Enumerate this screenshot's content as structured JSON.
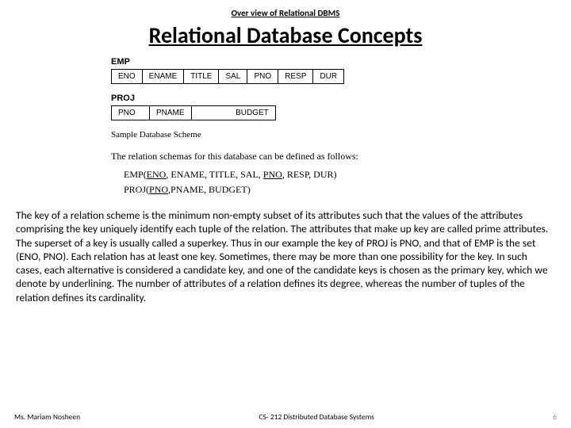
{
  "header": {
    "overline": "Over view of Relational DBMS"
  },
  "title": "Relational Database Concepts",
  "schemas": {
    "emp": {
      "label": "EMP",
      "cols": [
        "ENO",
        "ENAME",
        "TITLE",
        "SAL",
        "PNO",
        "RESP",
        "DUR"
      ]
    },
    "proj": {
      "label": "PROJ",
      "cols": [
        "PNO",
        "PNAME",
        "BUDGET"
      ]
    },
    "caption": "Sample Database Scheme",
    "intro": "The relation schemas for this database can be defined as follows:",
    "defs": {
      "emp_name": "EMP",
      "emp_key1": "ENO",
      "emp_rest1": ", ENAME, TITLE, SAL, ",
      "emp_key2": "PNO",
      "emp_rest2": ", RESP, DUR)",
      "proj_name": "PROJ",
      "proj_key": "PNO",
      "proj_rest": ",PNAME, BUDGET)"
    }
  },
  "body": "The key of a relation scheme is the minimum non-empty subset of its attributes such that the values of the attributes comprising the key uniquely identify each tuple of the relation. The attributes that make up key are called prime attributes. The superset of a key is usually called a superkey. Thus in our example the key of PROJ is PNO, and that of EMP is the set (ENO, PNO). Each relation has at least one key. Sometimes, there may be more than one possibility for the key. In such cases, each alternative is considered a candidate key, and one of the candidate keys is chosen as the primary key, which we denote by underlining. The number of attributes of a relation defines its degree, whereas the number of tuples of the relation defines its cardinality.",
  "footer": {
    "author": "Ms. Mariam Nosheen",
    "course": "CS- 212 Distributed Database Systems",
    "page": "6"
  }
}
